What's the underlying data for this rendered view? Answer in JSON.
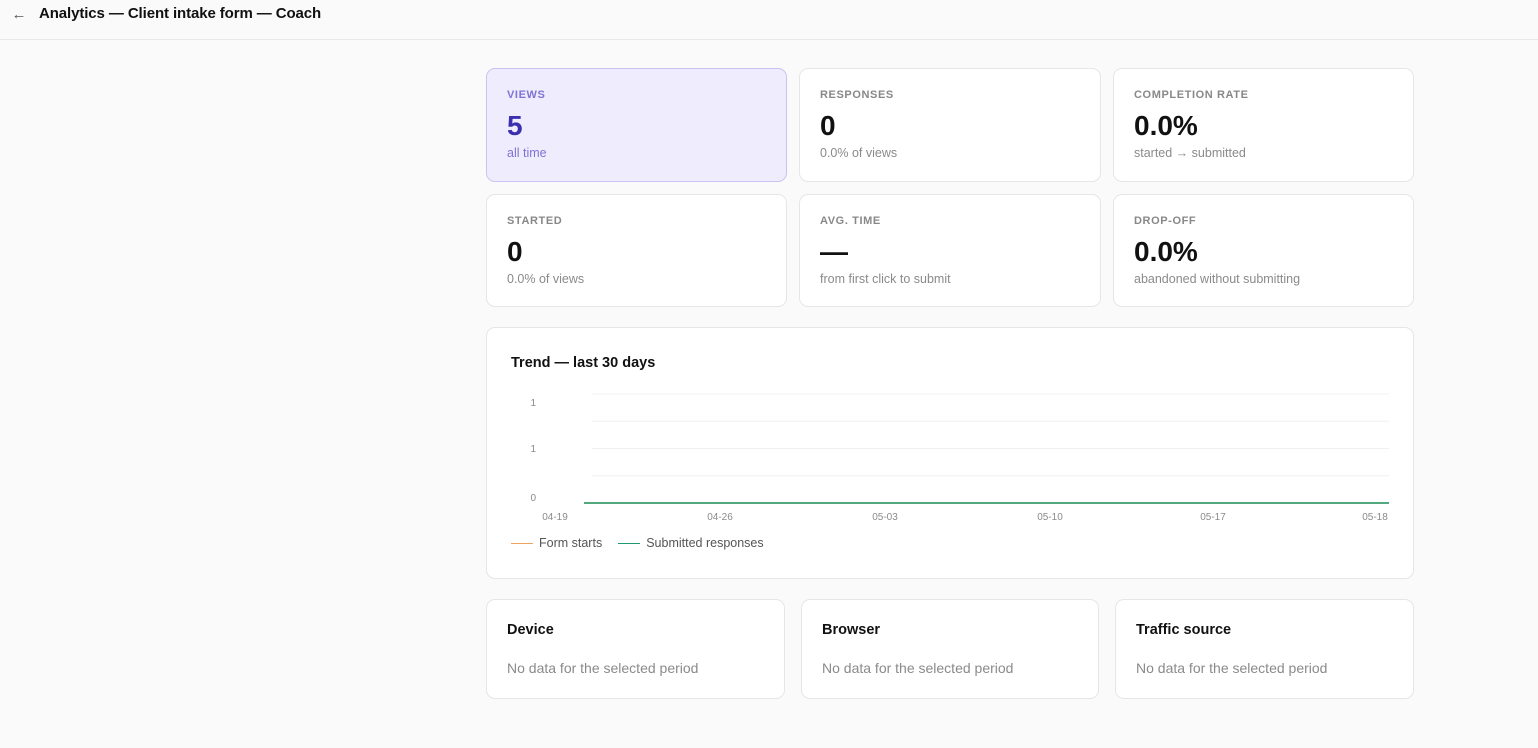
{
  "header": {
    "back_icon": "arrow-left-icon",
    "back_glyph": "←",
    "title": "Analytics — Client intake form — Coach"
  },
  "stats": [
    {
      "label": "VIEWS",
      "value": "5",
      "sub": "all time"
    },
    {
      "label": "RESPONSES",
      "value": "0",
      "sub": "0.0% of views"
    },
    {
      "label": "COMPLETION RATE",
      "value": "0.0%",
      "sub": "started → submitted"
    },
    {
      "label": "STARTED",
      "value": "0",
      "sub": "0.0% of views"
    },
    {
      "label": "AVG. TIME",
      "value": "—",
      "sub": "from first click to submit"
    },
    {
      "label": "DROP-OFF",
      "value": "0.0%",
      "sub": "abandoned without submitting"
    }
  ],
  "trend": {
    "title": "Trend — last 30 days",
    "legend": [
      {
        "name": "Form starts",
        "color": "#f0a35e"
      },
      {
        "name": "Submitted responses",
        "color": "#1f9a6e"
      }
    ]
  },
  "chart_data": {
    "type": "line",
    "title": "Trend — last 30 days",
    "x_ticks": [
      "04-19",
      "04-26",
      "05-03",
      "05-10",
      "05-17",
      "05-18"
    ],
    "y_ticks": [
      "0",
      "1",
      "1"
    ],
    "y_range": [
      0,
      1
    ],
    "grid": "horizontal",
    "legend_position": "bottom-left",
    "series": [
      {
        "name": "Form starts",
        "color": "#f0a35e",
        "values": [
          0,
          0,
          0,
          0,
          0,
          0,
          0,
          0,
          0,
          0,
          0,
          0,
          0,
          0,
          0,
          0,
          0,
          0,
          0,
          0,
          0,
          0,
          0,
          0,
          0,
          0,
          0,
          0,
          0,
          0
        ]
      },
      {
        "name": "Submitted responses",
        "color": "#1f9a6e",
        "values": [
          0,
          0,
          0,
          0,
          0,
          0,
          0,
          0,
          0,
          0,
          0,
          0,
          0,
          0,
          0,
          0,
          0,
          0,
          0,
          0,
          0,
          0,
          0,
          0,
          0,
          0,
          0,
          0,
          0,
          0
        ]
      }
    ]
  },
  "breakdowns": [
    {
      "title": "Device",
      "empty": "No data for the selected period"
    },
    {
      "title": "Browser",
      "empty": "No data for the selected period"
    },
    {
      "title": "Traffic source",
      "empty": "No data for the selected period"
    }
  ]
}
